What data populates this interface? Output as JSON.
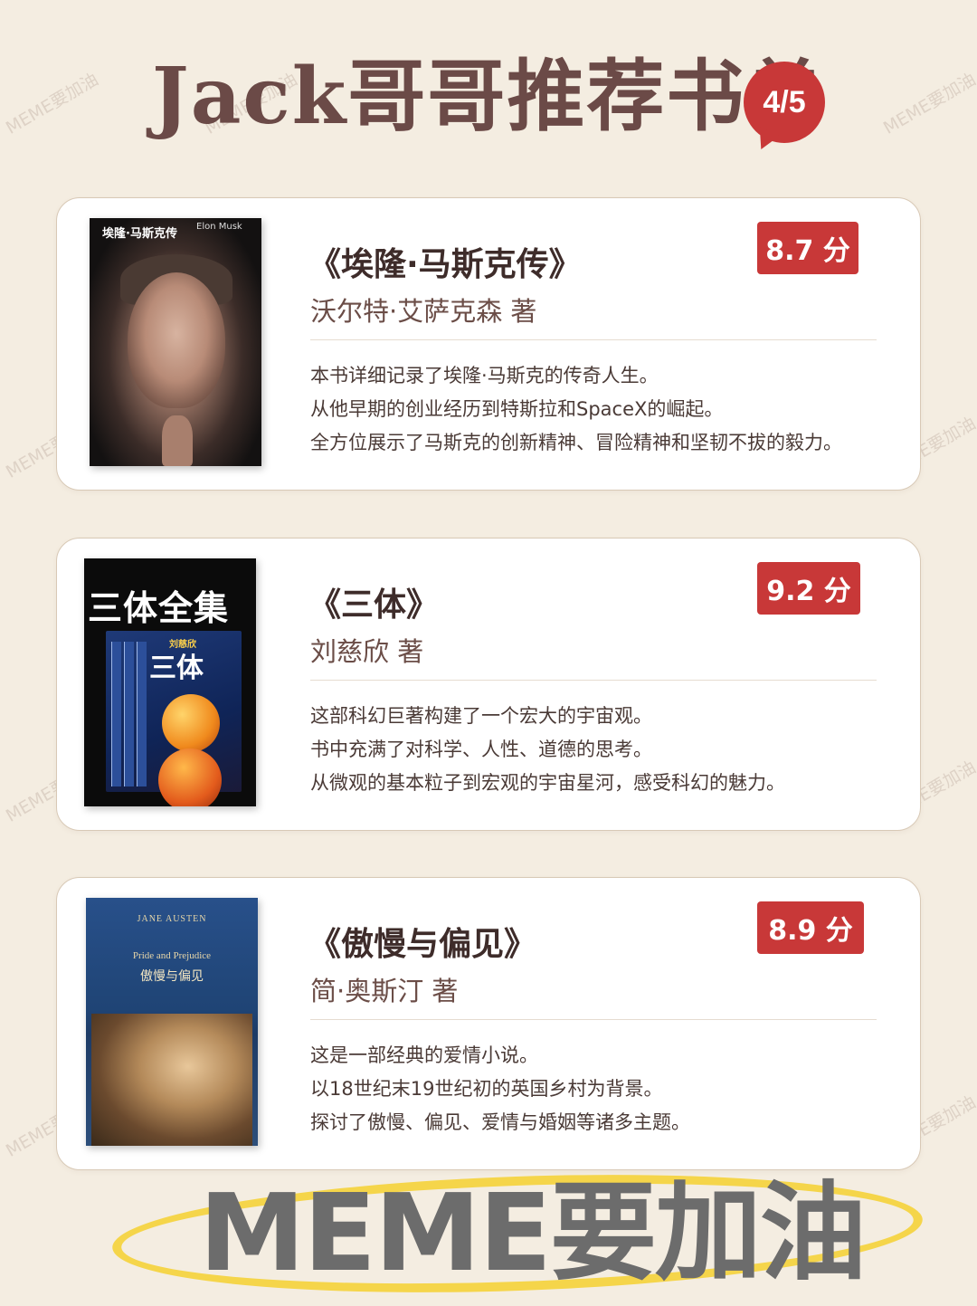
{
  "header": {
    "title": "Jack哥哥推荐书单",
    "page_indicator": "4/5"
  },
  "books": [
    {
      "cover_title": "埃隆·马斯克传",
      "cover_subtitle": "Elon Musk",
      "title": "《埃隆·马斯克传》",
      "author": "沃尔特·艾萨克森 著",
      "score": "8.7 分",
      "description": [
        "本书详细记录了埃隆·马斯克的传奇人生。",
        "从他早期的创业经历到特斯拉和SpaceX的崛起。",
        "全方位展示了马斯克的创新精神、冒险精神和坚韧不拔的毅力。"
      ]
    },
    {
      "cover_title": "三体全集",
      "cover_subtitle": "三体",
      "cover_author": "刘慈欣",
      "title": "《三体》",
      "author": "刘慈欣 著",
      "score": "9.2 分",
      "description": [
        "这部科幻巨著构建了一个宏大的宇宙观。",
        "书中充满了对科学、人性、道德的思考。",
        "从微观的基本粒子到宏观的宇宙星河，感受科幻的魅力。"
      ]
    },
    {
      "cover_author": "JANE AUSTEN",
      "cover_title_en": "Pride and Prejudice",
      "cover_title": "傲慢与偏见",
      "title": "《傲慢与偏见》",
      "author": "简·奥斯汀 著",
      "score": "8.9 分",
      "description": [
        "这是一部经典的爱情小说。",
        "以18世纪末19世纪初的英国乡村为背景。",
        "探讨了傲慢、偏见、爱情与婚姻等诸多主题。"
      ]
    }
  ],
  "watermark": "MEME要加油",
  "banner": {
    "text": "MEME要加油"
  },
  "colors": {
    "background": "#f4ede1",
    "accent_red": "#c83838",
    "title_brown": "#6b4a47",
    "banner_yellow": "#f5d54a",
    "banner_gray": "#6c6c6c"
  }
}
